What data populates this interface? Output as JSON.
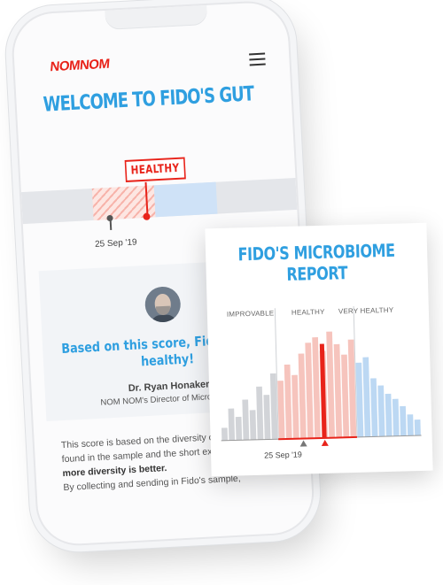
{
  "app": {
    "logo": "NOMNOM",
    "title": "WELCOME TO FIDO'S GUT"
  },
  "score": {
    "tag": "HEALTHY",
    "date": "25 Sep '19"
  },
  "card": {
    "quote": "Based on this score, Fido's gut is healthy!",
    "doctor_name": "Dr. Ryan Honaker",
    "doctor_role": "NOM NOM's Director of Microbiology"
  },
  "body": {
    "line1": "This score is based on the diversity of bacteria we found in the sample and the short explanation is that",
    "emphasis": "more diversity is better.",
    "line2": "By collecting and sending in Fido's sample,"
  },
  "report": {
    "title_line1": "FIDO'S MICROBIOME",
    "title_line2": "REPORT",
    "categories": [
      "IMPROVABLE",
      "HEALTHY",
      "VERY HEALTHY"
    ],
    "date": "25 Sep '19"
  },
  "chart_data": {
    "type": "bar",
    "values": [
      12,
      30,
      22,
      38,
      28,
      50,
      42,
      62,
      55,
      70,
      60,
      80,
      90,
      95,
      82,
      100,
      88,
      78,
      92,
      70,
      75,
      55,
      48,
      40,
      35,
      28,
      20,
      15
    ],
    "segments": [
      {
        "name": "IMPROVABLE",
        "range": [
          0,
          7
        ],
        "color": "#d2d4d8"
      },
      {
        "name": "HEALTHY",
        "range": [
          8,
          18
        ],
        "color": "#f6c4bd"
      },
      {
        "name": "VERY HEALTHY",
        "range": [
          19,
          27
        ],
        "color": "#bcd8f3"
      }
    ],
    "highlight_index": 14,
    "highlight_color": "#e8231a"
  }
}
